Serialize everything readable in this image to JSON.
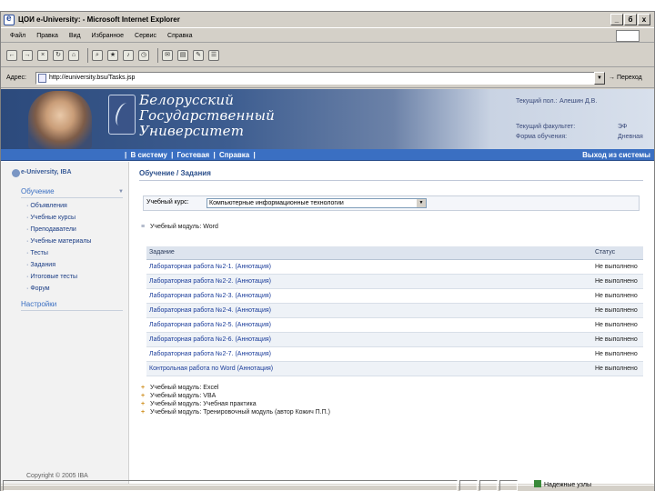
{
  "window": {
    "title": "ЦОИ e-University: - Microsoft Internet Explorer",
    "buttons": [
      "_",
      "б",
      "x"
    ]
  },
  "menu": [
    "Файл",
    "Правка",
    "Вид",
    "Избранное",
    "Сервис",
    "Справка"
  ],
  "toolbar_icons": [
    "back-icon",
    "forward-icon",
    "stop-icon",
    "refresh-icon",
    "home-icon",
    "search-icon",
    "favorites-icon",
    "media-icon",
    "history-icon",
    "mail-icon",
    "print-icon",
    "edit-icon",
    "discuss-icon"
  ],
  "address": {
    "label": "Адрес:",
    "url": "http://euniversity.bsu/Tasks.jsp",
    "go_label": "Переход"
  },
  "header": {
    "university": "Белорусский\nГосударственный\nУниверситет",
    "user_label": "Текущий пол.:",
    "user_value": "Алешин Д.В.",
    "faculty_label": "Текущий факультет:",
    "faculty_value": "ЭФ",
    "form_label": "Форма обучения:",
    "form_value": "Дневная"
  },
  "nav": {
    "links": [
      "В систему",
      "Гостевая",
      "Справка"
    ],
    "logout": "Выход из системы"
  },
  "sidebar": {
    "brand": "e-University, IBA",
    "section_learning": "Обучение",
    "items": [
      "Объявления",
      "Учебные курсы",
      "Преподаватели",
      "Учебные материалы",
      "Тесты",
      "Задания",
      "Итоговые тесты",
      "Форум"
    ],
    "section_settings": "Настройки",
    "copyright": "Copyright © 2005 IBA"
  },
  "main": {
    "title": "Обучение / Задания",
    "course_label": "Учебный курс:",
    "course_value": "Компьютерные информационные технологии",
    "current_module": "Учебный модуль: Word",
    "table": {
      "headers": [
        "Задание",
        "Статус"
      ],
      "rows": [
        {
          "task": "Лабораторная работа №2-1.  (Аннотация)",
          "status": "Не выполнено"
        },
        {
          "task": "Лабораторная работа №2-2.  (Аннотация)",
          "status": "Не выполнено"
        },
        {
          "task": "Лабораторная работа №2-3.  (Аннотация)",
          "status": "Не выполнено"
        },
        {
          "task": "Лабораторная работа №2-4.  (Аннотация)",
          "status": "Не выполнено"
        },
        {
          "task": "Лабораторная работа №2-5.  (Аннотация)",
          "status": "Не выполнено"
        },
        {
          "task": "Лабораторная работа №2-6.  (Аннотация)",
          "status": "Не выполнено"
        },
        {
          "task": "Лабораторная работа №2-7.  (Аннотация)",
          "status": "Не выполнено"
        },
        {
          "task": "Контрольная работа по Word  (Аннотация)",
          "status": "Не выполнено"
        }
      ]
    },
    "other_modules": [
      "Учебный модуль: Excel",
      "Учебный модуль: VBA",
      "Учебный модуль: Учебная практика",
      "Учебный модуль: Тренировочный модуль (автор Кожич П.П.)"
    ]
  },
  "status": {
    "zone": "Надежные узлы"
  }
}
